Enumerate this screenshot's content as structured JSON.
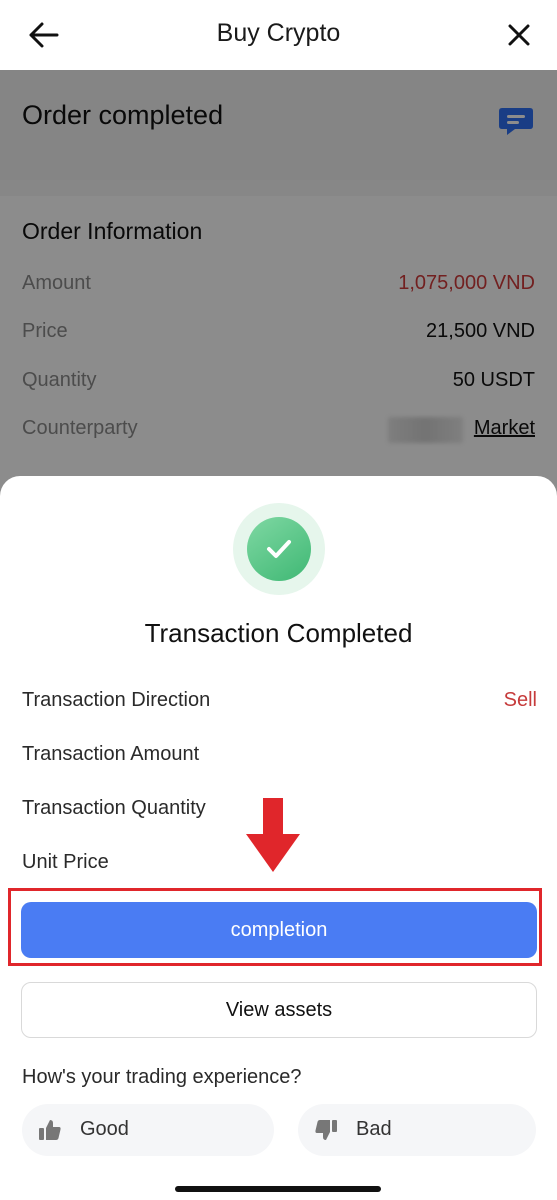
{
  "header": {
    "title": "Buy Crypto"
  },
  "order": {
    "status": "Order completed",
    "info_heading": "Order Information",
    "rows": [
      {
        "label": "Amount",
        "value": "1,075,000 VND"
      },
      {
        "label": "Price",
        "value": "21,500 VND"
      },
      {
        "label": "Quantity",
        "value": "50 USDT"
      },
      {
        "label": "Counterparty",
        "value": "Market"
      }
    ]
  },
  "sheet": {
    "title": "Transaction Completed",
    "rows": [
      {
        "label": "Transaction Direction",
        "value": "Sell"
      },
      {
        "label": "Transaction Amount",
        "value": ""
      },
      {
        "label": "Transaction Quantity",
        "value": ""
      },
      {
        "label": "Unit Price",
        "value": ""
      }
    ],
    "primary_button": "completion",
    "secondary_button": "View assets",
    "feedback_question": "How's your trading experience?",
    "good_label": "Good",
    "bad_label": "Bad"
  },
  "colors": {
    "accent": "#4a7cf3",
    "sell_red": "#c63b3b",
    "success_green": "#3fb874",
    "highlight_red": "#e0262b"
  },
  "icons": [
    "back-arrow-icon",
    "close-icon",
    "chat-icon",
    "check-icon",
    "down-arrow-icon",
    "thumbs-up-icon",
    "thumbs-down-icon"
  ]
}
